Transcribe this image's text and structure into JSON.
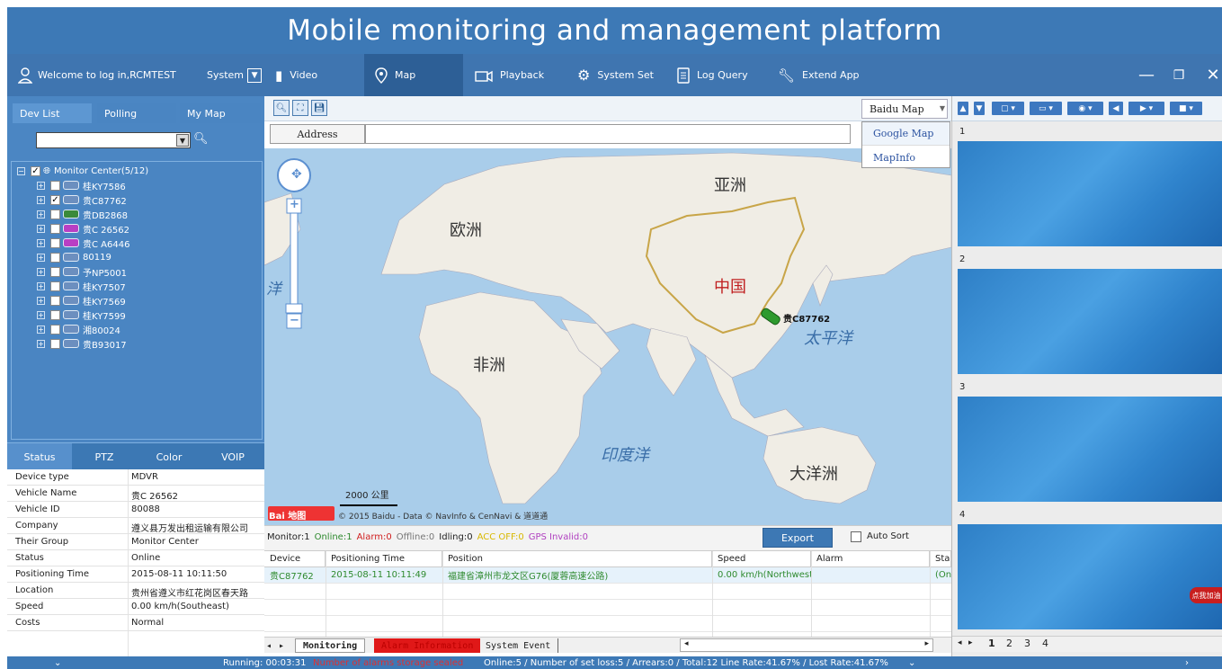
{
  "header": {
    "title": "Mobile monitoring and management platform"
  },
  "nav": {
    "welcome": "Welcome to log in,RCMTEST",
    "system": "System",
    "tabs": [
      {
        "label": "Video",
        "icon": "film-icon"
      },
      {
        "label": "Map",
        "icon": "location-pin-icon"
      },
      {
        "label": "Playback",
        "icon": "camera-playback-icon"
      },
      {
        "label": "System Set",
        "icon": "settings-icon"
      },
      {
        "label": "Log Query",
        "icon": "document-icon"
      },
      {
        "label": "Extend App",
        "icon": "wrench-icon"
      }
    ],
    "active_tab": "Map"
  },
  "left": {
    "tabs": [
      "Dev List",
      "Polling",
      "My Map"
    ],
    "tree_root": "Monitor Center(5/12)",
    "vehicles": [
      {
        "name": "桂KY7586",
        "checked": false,
        "color": "#6c8fbf"
      },
      {
        "name": "贵C87762",
        "checked": true,
        "color": "#6c8fbf"
      },
      {
        "name": "贵DB2868",
        "checked": false,
        "color": "#3a8a3a"
      },
      {
        "name": "贵C 26562",
        "checked": false,
        "color": "#b93fc4"
      },
      {
        "name": "贵C A6446",
        "checked": false,
        "color": "#b93fc4"
      },
      {
        "name": "80119",
        "checked": false,
        "color": "#6c8fbf"
      },
      {
        "name": "予NP5001",
        "checked": false,
        "color": "#6c8fbf"
      },
      {
        "name": "桂KY7507",
        "checked": false,
        "color": "#6c8fbf"
      },
      {
        "name": "桂KY7569",
        "checked": false,
        "color": "#6c8fbf"
      },
      {
        "name": "桂KY7599",
        "checked": false,
        "color": "#6c8fbf"
      },
      {
        "name": "湘80024",
        "checked": false,
        "color": "#6c8fbf"
      },
      {
        "name": "贵B93017",
        "checked": false,
        "color": "#6c8fbf"
      }
    ],
    "status_tabs": [
      "Status",
      "PTZ",
      "Color",
      "VOIP"
    ],
    "status_rows": [
      {
        "label": "Device type",
        "value": "MDVR"
      },
      {
        "label": "Vehicle Name",
        "value": "贵C 26562"
      },
      {
        "label": "Vehicle ID",
        "value": "80088"
      },
      {
        "label": "Company",
        "value": "遵义县万发出租运输有限公司"
      },
      {
        "label": "Their Group",
        "value": "Monitor Center"
      },
      {
        "label": "Status",
        "value": "Online"
      },
      {
        "label": "Positioning Time",
        "value": "2015-08-11 10:11:50"
      },
      {
        "label": "Location",
        "value": "贵州省遵义市红花岗区春天路"
      },
      {
        "label": "Speed",
        "value": "0.00 km/h(Southeast)"
      },
      {
        "label": "Costs",
        "value": "Normal"
      }
    ]
  },
  "map": {
    "provider_selected": "Baidu Map",
    "provider_options": [
      "Google Map",
      "MapInfo"
    ],
    "address_button": "Address",
    "labels": {
      "asia": "亚洲",
      "europe": "欧洲",
      "china": "中国",
      "africa": "非洲",
      "pacific": "太平洋",
      "indian": "印度洋",
      "oceania": "大洋洲",
      "ocean_left": "洋"
    },
    "vehicle_label": "贵C87762",
    "scale": "2000 公里",
    "copyright": "© 2015 Baidu - Data © NavInfo & CenNavi & 道道通",
    "logo_text": "Bai 地图"
  },
  "monitor": {
    "summary": [
      {
        "text": "Monitor:1",
        "color": "#222"
      },
      {
        "text": "Online:1",
        "color": "#2e8a2e"
      },
      {
        "text": "Alarm:0",
        "color": "#d02020"
      },
      {
        "text": "Offline:0",
        "color": "#777"
      },
      {
        "text": "Idling:0",
        "color": "#222"
      },
      {
        "text": "ACC OFF:0",
        "color": "#d8b800"
      },
      {
        "text": "GPS Invalid:0",
        "color": "#b040c0"
      }
    ],
    "export_label": "Export",
    "auto_sort_label": "Auto Sort",
    "columns": [
      "Device",
      "Positioning Time",
      "Position",
      "Speed",
      "Alarm",
      "Sta"
    ],
    "row": [
      "贵C87762",
      "2015-08-11 10:11:49",
      "福建省漳州市龙文区G76(厦蓉高速公路)",
      "0.00 km/h(Northwest)",
      "",
      "(On"
    ],
    "bottom_tabs": [
      "Monitoring",
      "Alarm Information",
      "System Event"
    ]
  },
  "right": {
    "video_numbers": [
      "1",
      "2",
      "3",
      "4"
    ],
    "page_tabs": [
      "1",
      "2",
      "3",
      "4"
    ],
    "float_ad": "点我加油"
  },
  "footer": {
    "running": "Running: 00:03:31",
    "alert": "Number of alarms storage sealed",
    "stats": "Online:5 / Number of set loss:5 / Arrears:0 / Total:12   Line Rate:41.67% / Lost Rate:41.67%"
  }
}
